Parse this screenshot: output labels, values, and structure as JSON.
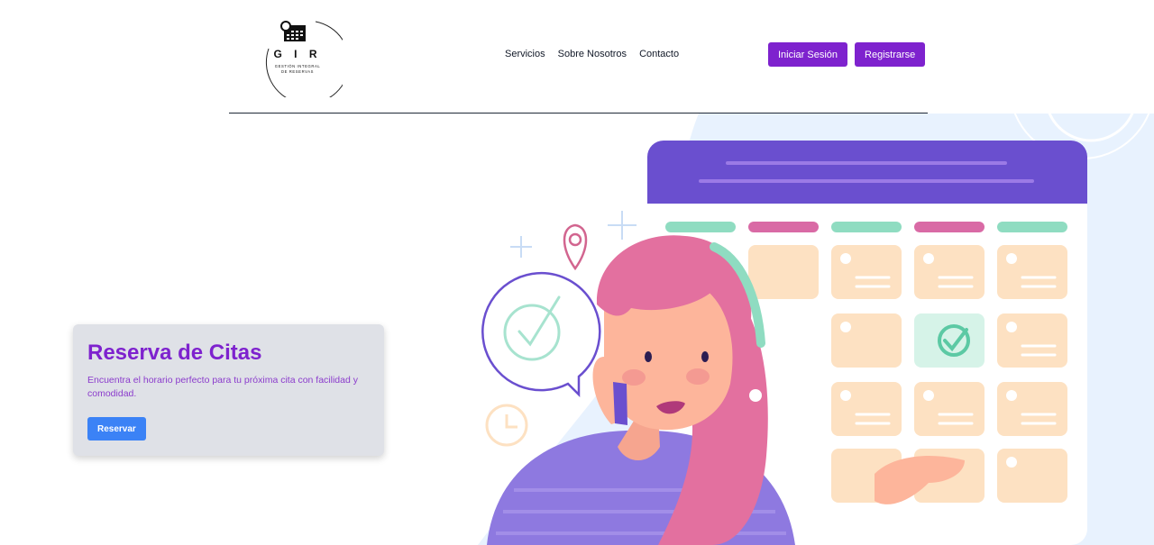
{
  "brand": {
    "logo_letters": "G I R",
    "logo_subtitle_line1": "GESTIÓN INTEGRAL",
    "logo_subtitle_line2": "DE RESERVAS"
  },
  "nav": {
    "items": [
      "Servicios",
      "Sobre Nosotros",
      "Contacto"
    ]
  },
  "auth": {
    "login_label": "Iniciar Sesión",
    "register_label": "Registrarse"
  },
  "hero": {
    "title": "Reserva de Citas",
    "description": "Encuentra el horario perfecto para tu próxima cita con facilidad y comodidad.",
    "cta_label": "Reservar"
  },
  "colors": {
    "primary_purple": "#7e22ce",
    "cta_blue": "#3b82f6",
    "card_bg": "#dfe1e7"
  }
}
